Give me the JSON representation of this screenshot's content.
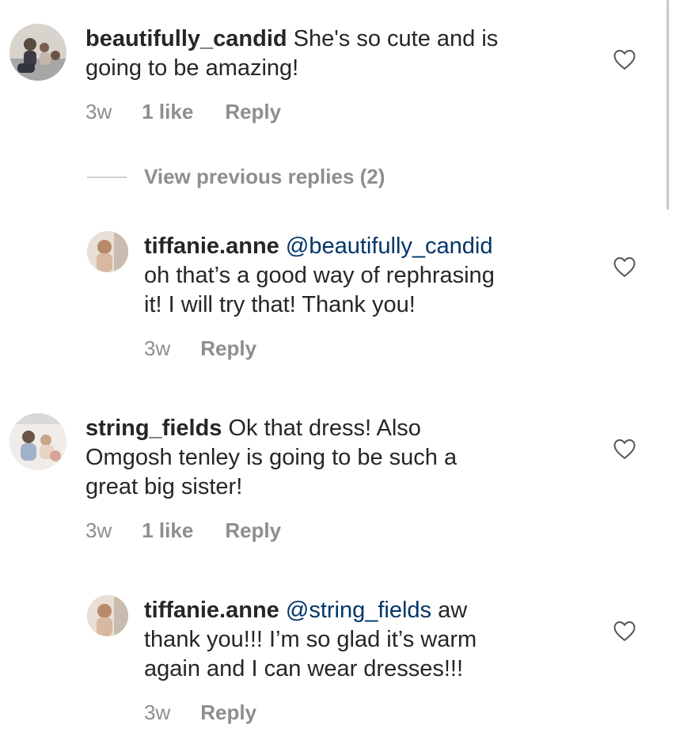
{
  "comments": [
    {
      "username": "beautifully_candid",
      "text_lines": [
        "She's so cute and is",
        "going to be amazing!"
      ],
      "time": "3w",
      "likes": "1 like",
      "reply": "Reply"
    },
    {
      "username": "tiffanie.anne",
      "mention": "@beautifully_candid",
      "text_lines": [
        "oh that’s a good way of rephrasing",
        "it! I will try that! Thank you!"
      ],
      "time": "3w",
      "reply": "Reply"
    },
    {
      "username": "string_fields",
      "text_lines": [
        "Ok that dress! Also",
        "Omgosh tenley is going to be such a",
        "great big sister!"
      ],
      "time": "3w",
      "likes": "1 like",
      "reply": "Reply"
    },
    {
      "username": "tiffanie.anne",
      "mention": "@string_fields",
      "text_lines": [
        "aw",
        "thank you!!! I’m so glad it’s warm",
        "again and I can wear dresses!!!"
      ],
      "time": "3w",
      "reply": "Reply"
    }
  ],
  "view_previous_replies": "View previous replies (2)",
  "icons": {
    "like": "heart-outline-icon",
    "avatar": "user-avatar"
  },
  "colors": {
    "text": "#262626",
    "meta": "#8e8e8e",
    "mention": "#003569",
    "background": "#ffffff"
  }
}
